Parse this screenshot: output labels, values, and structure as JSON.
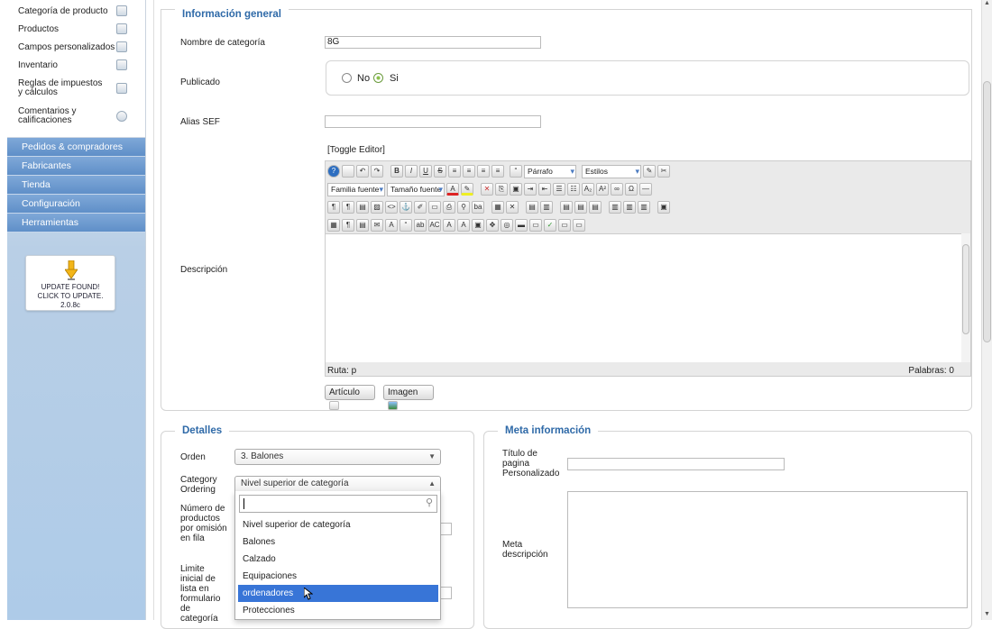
{
  "sidebar": {
    "sub_items": [
      {
        "label": "Categoría de producto",
        "icon": "folder-icon"
      },
      {
        "label": "Productos",
        "icon": "box-icon"
      },
      {
        "label": "Campos personalizados",
        "icon": "fields-icon"
      },
      {
        "label": "Inventario",
        "icon": "inventory-icon"
      },
      {
        "label": "Reglas de impuestos y cálculos",
        "icon": "calculator-icon"
      },
      {
        "label": "Comentarios y calificaciones",
        "icon": "comment-icon"
      }
    ],
    "main_items": [
      "Pedidos & compradores",
      "Fabricantes",
      "Tienda",
      "Configuración",
      "Herramientas"
    ],
    "update": {
      "line1": "UPDATE FOUND!",
      "line2": "CLICK TO UPDATE.",
      "version": "2.0.8c"
    }
  },
  "general": {
    "legend": "Información general",
    "name_label": "Nombre de categoría",
    "name_value": "8G",
    "published_label": "Publicado",
    "published_no": "No",
    "published_yes": "Si",
    "published_value": "Si",
    "alias_label": "Alias SEF",
    "alias_value": "",
    "description_label": "Descripción",
    "toggle_editor": "[Toggle Editor]",
    "format_select": "Párrafo",
    "styles_select": "Estilos",
    "font_family": "Familia fuente",
    "font_size": "Tamaño fuente",
    "path_label": "Ruta: p",
    "words_label": "Palabras: 0",
    "article_button": "Artículo",
    "image_button": "Imagen"
  },
  "details": {
    "legend": "Detalles",
    "order_label": "Orden",
    "order_value": "3. Balones",
    "cat_ordering_label": "Category Ordering",
    "cat_ordering_value": "Nivel superior de categoría",
    "products_per_row_label": "Número de productos por omisión en fila",
    "list_limit_label": "Limite inicial de lista en formulario de categoría",
    "dropdown_options": [
      "Nivel superior de categoría",
      "Balones",
      "Calzado",
      "Equipaciones",
      "ordenadores",
      "Protecciones"
    ],
    "highlighted_option": "ordenadores"
  },
  "meta": {
    "legend": "Meta información",
    "title_label": "Título de pagina Personalizado",
    "title_value": "",
    "description_label": "Meta descripción",
    "description_value": ""
  }
}
